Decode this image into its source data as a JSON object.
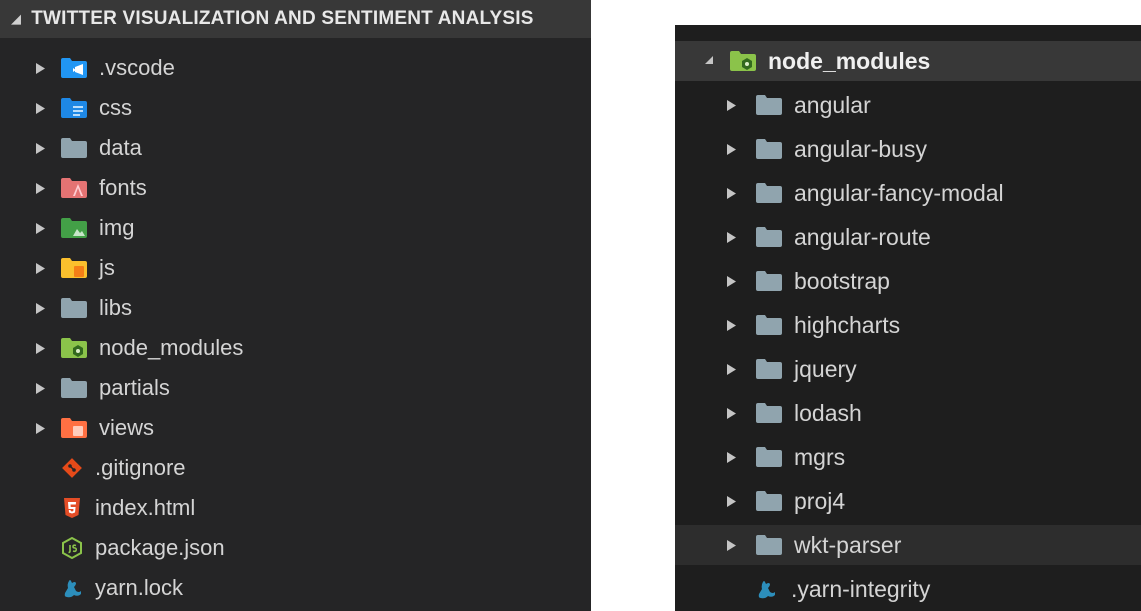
{
  "left_panel": {
    "header": {
      "title": "TWITTER VISUALIZATION AND SENTIMENT ANALYSIS"
    },
    "items": [
      {
        "label": ".vscode",
        "icon": "vscode-folder-icon"
      },
      {
        "label": "css",
        "icon": "css-folder-icon"
      },
      {
        "label": "data",
        "icon": "folder-icon"
      },
      {
        "label": "fonts",
        "icon": "fonts-folder-icon"
      },
      {
        "label": "img",
        "icon": "images-folder-icon"
      },
      {
        "label": "js",
        "icon": "js-folder-icon"
      },
      {
        "label": "libs",
        "icon": "folder-icon"
      },
      {
        "label": "node_modules",
        "icon": "node-folder-icon"
      },
      {
        "label": "partials",
        "icon": "folder-icon"
      },
      {
        "label": "views",
        "icon": "views-folder-icon"
      },
      {
        "label": ".gitignore",
        "icon": "git-icon"
      },
      {
        "label": "index.html",
        "icon": "html5-icon"
      },
      {
        "label": "package.json",
        "icon": "nodejs-icon"
      },
      {
        "label": "yarn.lock",
        "icon": "yarn-icon"
      }
    ]
  },
  "right_panel": {
    "root": {
      "label": "node_modules",
      "icon": "node-folder-icon"
    },
    "items": [
      {
        "label": "angular"
      },
      {
        "label": "angular-busy"
      },
      {
        "label": "angular-fancy-modal"
      },
      {
        "label": "angular-route"
      },
      {
        "label": "bootstrap"
      },
      {
        "label": "highcharts"
      },
      {
        "label": "jquery"
      },
      {
        "label": "lodash"
      },
      {
        "label": "mgrs"
      },
      {
        "label": "proj4"
      },
      {
        "label": "wkt-parser"
      }
    ],
    "file": {
      "label": ".yarn-integrity",
      "icon": "yarn-icon"
    }
  },
  "colors": {
    "panel_bg": "#252526",
    "header_bg": "#383838",
    "text": "#d4d4d4",
    "folder_grey": "#90a4ae",
    "vscode_blue": "#2196f3",
    "css_blue": "#1e88e5",
    "fonts_red": "#e57373",
    "img_green": "#43a047",
    "js_yellow": "#fbc02d",
    "node_green": "#8bc34a",
    "views_orange": "#ff7043",
    "git_orange": "#e64a19",
    "html_orange": "#e44d26",
    "yarn_blue": "#2c8ebb"
  }
}
